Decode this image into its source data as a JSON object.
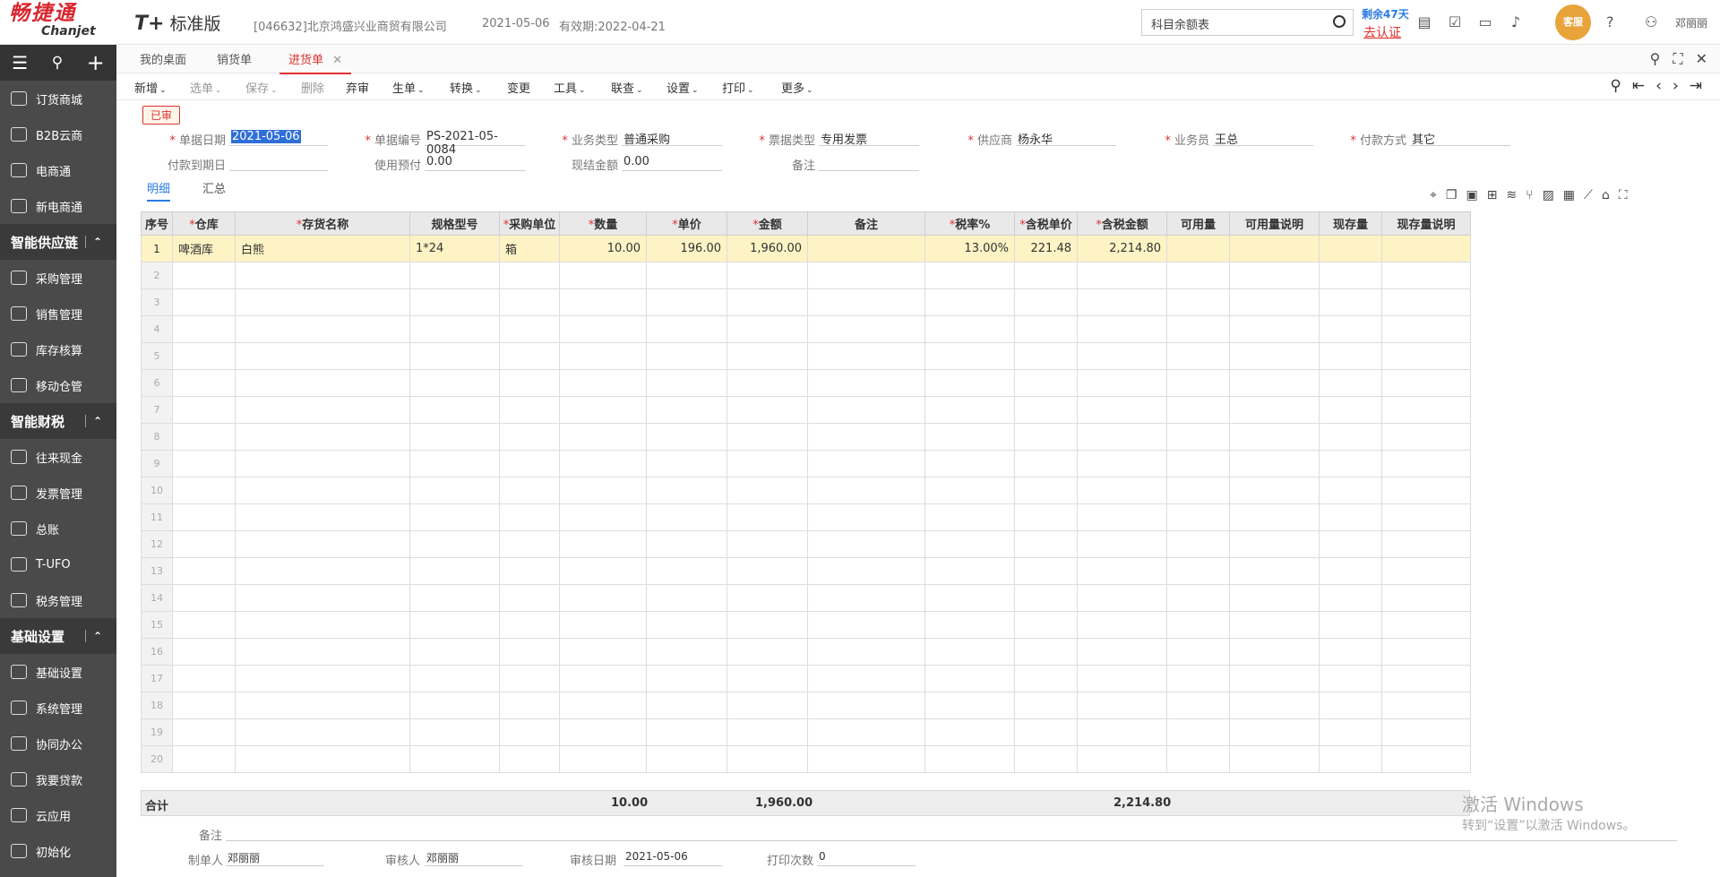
{
  "header": {
    "brand_cn": "畅捷通",
    "brand_en": "Chanjet",
    "edition_mark": "T+",
    "edition_name": "标准版",
    "company": "[046632]北京鸿盛兴业商贸有限公司",
    "date": "2021-05-06",
    "validity": "有效期:2022-04-21",
    "search_value": "科目余额表",
    "remain": "剩余47天",
    "certify": "去认证",
    "mascot": "客服",
    "user": "邓丽丽"
  },
  "sidebar": {
    "top_icons": [
      "≡",
      "⚲",
      "+"
    ],
    "groups": [
      {
        "type": "item",
        "label": "订货商城",
        "icon": "store-icon"
      },
      {
        "type": "item",
        "label": "B2B云商",
        "icon": "bag-icon"
      },
      {
        "type": "item",
        "label": "电商通",
        "icon": "ecommerce-icon"
      },
      {
        "type": "item",
        "label": "新电商通",
        "icon": "new-ecommerce-icon"
      },
      {
        "type": "section",
        "label": "智能供应链"
      },
      {
        "type": "item",
        "label": "采购管理",
        "icon": "cart-icon"
      },
      {
        "type": "item",
        "label": "销售管理",
        "icon": "chart-icon"
      },
      {
        "type": "item",
        "label": "库存核算",
        "icon": "warehouse-icon"
      },
      {
        "type": "item",
        "label": "移动仓管",
        "icon": "mobile-warehouse-icon"
      },
      {
        "type": "section",
        "label": "智能财税"
      },
      {
        "type": "item",
        "label": "往来现金",
        "icon": "exchange-icon"
      },
      {
        "type": "item",
        "label": "发票管理",
        "icon": "invoice-icon"
      },
      {
        "type": "item",
        "label": "总账",
        "icon": "ledger-icon"
      },
      {
        "type": "item",
        "label": "T-UFO",
        "icon": "building-icon"
      },
      {
        "type": "item",
        "label": "税务管理",
        "icon": "tax-icon"
      },
      {
        "type": "section",
        "label": "基础设置"
      },
      {
        "type": "item",
        "label": "基础设置",
        "icon": "settings-icon"
      },
      {
        "type": "item",
        "label": "系统管理",
        "icon": "system-icon"
      },
      {
        "type": "item",
        "label": "协同办公",
        "icon": "collab-icon"
      },
      {
        "type": "item",
        "label": "我要贷款",
        "icon": "loan-icon"
      },
      {
        "type": "item",
        "label": "云应用",
        "icon": "cloud-icon"
      },
      {
        "type": "item",
        "label": "初始化",
        "icon": "init-icon"
      }
    ]
  },
  "tabs": [
    {
      "label": "我的桌面"
    },
    {
      "label": "销货单"
    },
    {
      "label": "进货单",
      "active": true
    }
  ],
  "toolbar": [
    {
      "label": "新增",
      "dd": true
    },
    {
      "label": "选单",
      "dd": true,
      "disabled": true
    },
    {
      "label": "保存",
      "dd": true,
      "disabled": true
    },
    {
      "label": "删除",
      "disabled": true
    },
    {
      "label": "弃审"
    },
    {
      "label": "生单",
      "dd": true
    },
    {
      "label": "转换",
      "dd": true
    },
    {
      "label": "变更"
    },
    {
      "label": "工具",
      "dd": true
    },
    {
      "label": "联查",
      "dd": true
    },
    {
      "label": "设置",
      "dd": true
    },
    {
      "label": "打印",
      "dd": true
    },
    {
      "label": "更多",
      "dd": true
    }
  ],
  "status": "已审",
  "form": {
    "bill_date_label": "单据日期",
    "bill_date": "2021-05-06",
    "bill_no_label": "单据编号",
    "bill_no": "PS-2021-05-0084",
    "biz_type_label": "业务类型",
    "biz_type": "普通采购",
    "invoice_type_label": "票据类型",
    "invoice_type": "专用发票",
    "supplier_label": "供应商",
    "supplier": "杨永华",
    "salesman_label": "业务员",
    "salesman": "王总",
    "pay_method_label": "付款方式",
    "pay_method": "其它",
    "due_label": "付款到期日",
    "due": "",
    "prepay_label": "使用预付",
    "prepay": "0.00",
    "cash_label": "现结金额",
    "cash": "0.00",
    "memo_label": "备注",
    "memo": ""
  },
  "subtabs": [
    "明细",
    "汇总"
  ],
  "table": {
    "headers": [
      "序号",
      "仓库",
      "存货名称",
      "规格型号",
      "采购单位",
      "数量",
      "单价",
      "金额",
      "备注",
      "税率%",
      "含税单价",
      "含税金额",
      "可用量",
      "可用量说明",
      "现存量",
      "现存量说明"
    ],
    "rows": [
      [
        "1",
        "啤酒库",
        "白熊",
        "1*24",
        "箱",
        "10.00",
        "196.00",
        "1,960.00",
        "",
        "13.00%",
        "221.48",
        "2,214.80",
        "",
        "",
        "",
        ""
      ]
    ],
    "empty_rows": [
      "2",
      "3",
      "4",
      "5",
      "6",
      "7",
      "8",
      "9",
      "10",
      "11",
      "12",
      "13",
      "14",
      "15",
      "16",
      "17",
      "18",
      "19",
      "20"
    ]
  },
  "totals": {
    "label": "合计",
    "qty": "10.00",
    "amount": "1,960.00",
    "tax_amount": "2,214.80"
  },
  "footer": {
    "memo_label": "备注",
    "maker_label": "制单人",
    "maker": "邓丽丽",
    "auditor_label": "审核人",
    "auditor": "邓丽丽",
    "audit_date_label": "审核日期",
    "audit_date": "2021-05-06",
    "print_label": "打印次数",
    "print_count": "0"
  },
  "watermark": {
    "line1": "激活 Windows",
    "line2": "转到“设置”以激活 Windows。"
  }
}
